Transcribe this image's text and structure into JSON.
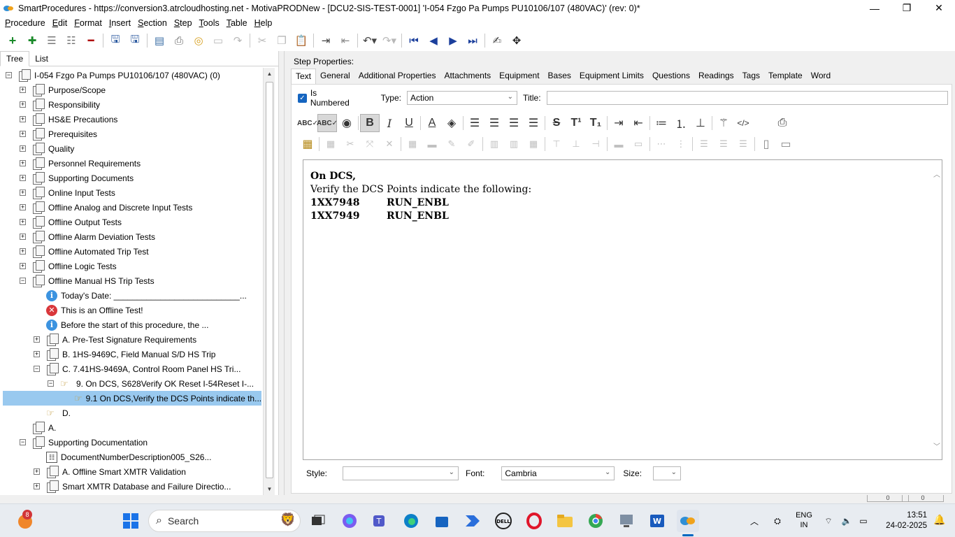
{
  "window": {
    "title": "SmartProcedures - https://conversion3.atrcloudhosting.net - MotivaPRODNew - [DCU2-SIS-TEST-0001] 'I-054 Fzgo Pa Pumps PU10106/107 (480VAC)' (rev: 0)*",
    "minimize": "—",
    "maximize": "❐",
    "close": "✕"
  },
  "menu": [
    {
      "ul": "P",
      "rest": "rocedure"
    },
    {
      "ul": "E",
      "rest": "dit"
    },
    {
      "ul": "F",
      "rest": "ormat"
    },
    {
      "ul": "I",
      "rest": "nsert"
    },
    {
      "ul": "S",
      "rest": "ection"
    },
    {
      "ul": "S",
      "rest": "tep"
    },
    {
      "ul": "T",
      "rest": "ools"
    },
    {
      "ul": "T",
      "rest": "able"
    },
    {
      "ul": "H",
      "rest": "elp"
    }
  ],
  "left_tabs": {
    "tree": "Tree",
    "list": "List"
  },
  "tree": {
    "root": "I-054 Fzgo Pa Pumps PU10106/107 (480VAC) (0)",
    "sections": [
      "Purpose/Scope",
      "Responsibility",
      "HS&E Precautions",
      "Prerequisites",
      "Quality",
      "Personnel Requirements",
      "Supporting Documents",
      "Online Input Tests",
      "Offline Analog and Discrete Input Tests",
      "Offline Output Tests",
      "Offline Alarm Deviation Tests",
      "Offline Automated Trip Test",
      "Offline Logic Tests"
    ],
    "expanded_section": "Offline Manual HS Trip Tests",
    "info1": "Today's Date: ___________________________...",
    "error1": "This is an Offline Test!",
    "info2": "Before the start of this procedure, the ...",
    "sub_a": "A. Pre-Test Signature Requirements",
    "sub_b": "B. 1HS-9469C, Field Manual S/D HS Trip",
    "sub_c": "C. 7.41HS-9469A, Control Room Panel HS Tri...",
    "step9": "9. On DCS, S628Verify OK Reset I-54Reset I-...",
    "step91": "9.1 On DCS,Verify the DCS Points indicate th...",
    "step_d": "D.",
    "sec_a": "A.",
    "supporting_documentation": "Supporting Documentation",
    "doc_number": "DocumentNumberDescription005_S26...",
    "offline_smart": "A. Offline Smart XMTR Validation",
    "smart_db": "Smart XMTR Database and Failure Directio..."
  },
  "step_properties": {
    "label": "Step Properties:",
    "tabs": [
      "Text",
      "General",
      "Additional Properties",
      "Attachments",
      "Equipment",
      "Bases",
      "Equipment Limits",
      "Questions",
      "Readings",
      "Tags",
      "Template",
      "Word"
    ],
    "is_numbered_label": "Is Numbered",
    "type_label": "Type:",
    "type_value": "Action",
    "title_label": "Title:",
    "title_value": ""
  },
  "editor": {
    "line1": "On DCS,",
    "line2": "Verify the DCS Points indicate the following:",
    "rows": [
      {
        "point": "1XX7948",
        "state": "RUN_ENBL"
      },
      {
        "point": "1XX7949",
        "state": "RUN_ENBL"
      }
    ]
  },
  "style_row": {
    "style_label": "Style:",
    "style_value": "",
    "font_label": "Font:",
    "font_value": "Cambria",
    "size_label": "Size:",
    "size_value": ""
  },
  "statusbar": {
    "p1": "0",
    "p2": "0"
  },
  "taskbar": {
    "search": "Search",
    "badge": "8",
    "lang1": "ENG",
    "lang2": "IN",
    "time": "13:51",
    "date": "24-02-2025"
  },
  "colors": {
    "accent": "#1565c0",
    "selection": "#99c9ef",
    "info": "#3c93e0",
    "error": "#d9373b"
  }
}
